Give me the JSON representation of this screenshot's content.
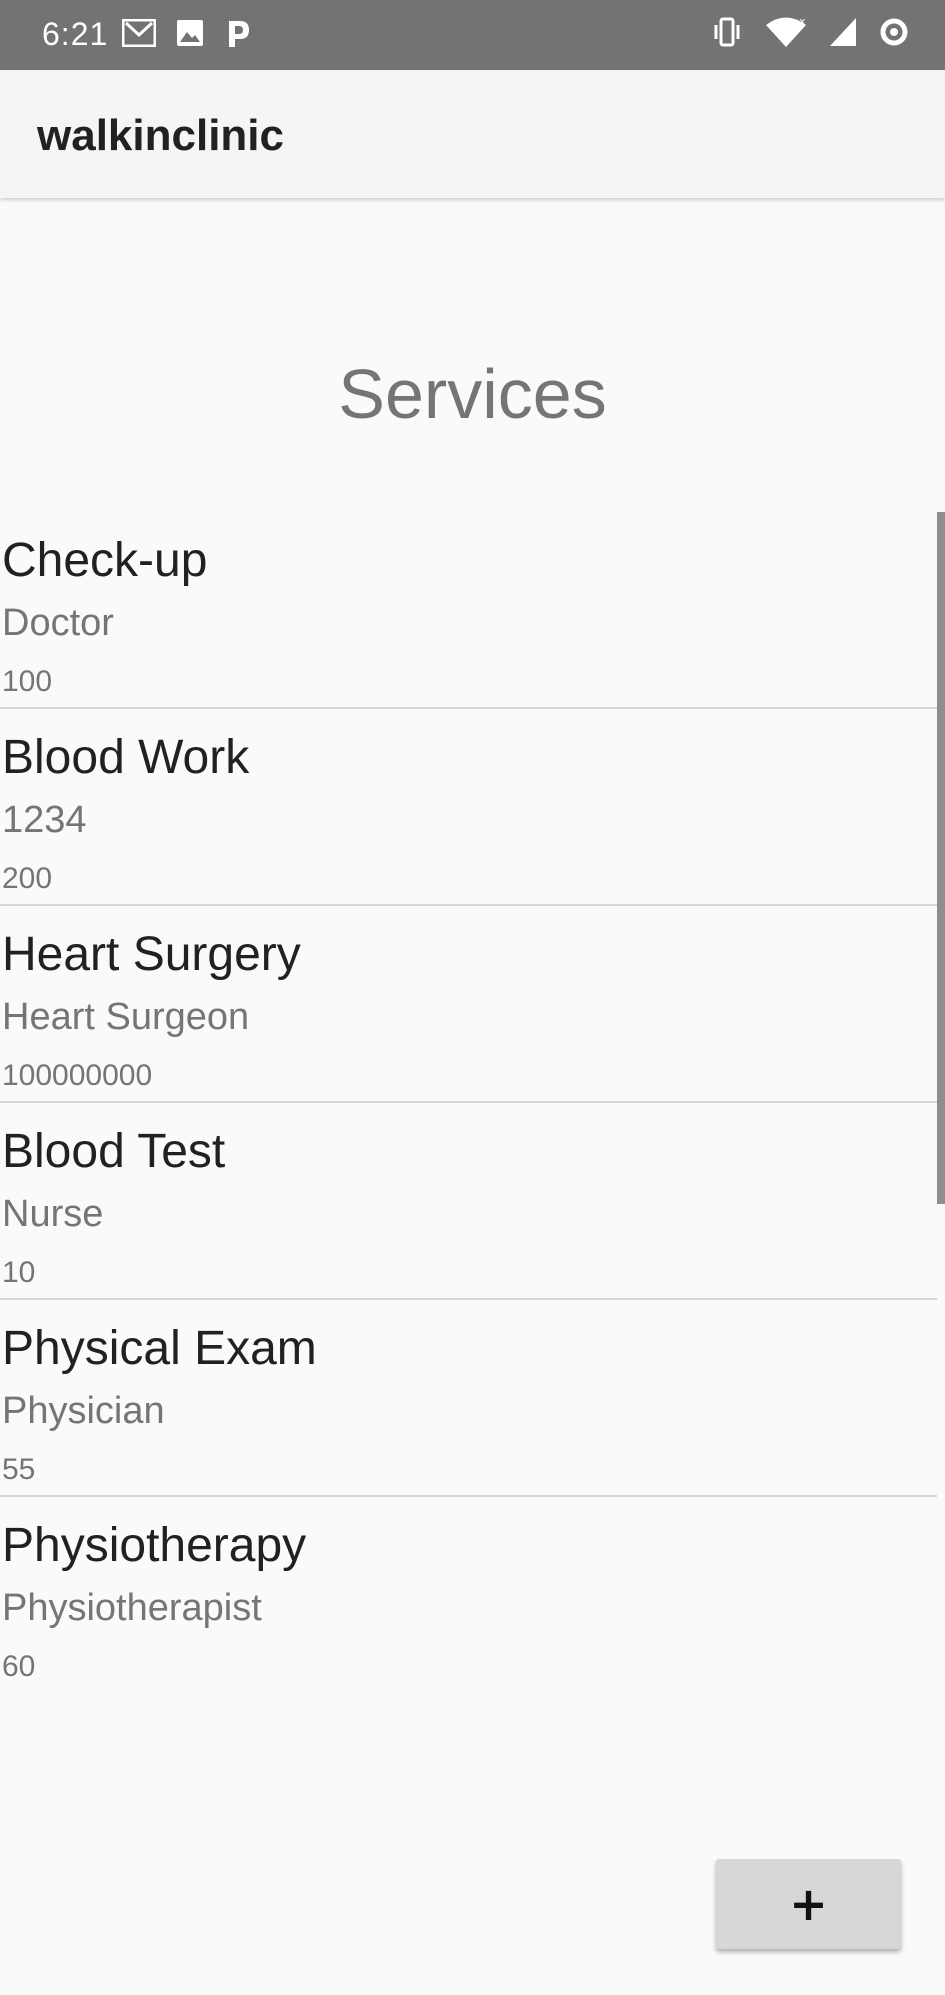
{
  "status_bar": {
    "time": "6:21",
    "left_icons": [
      "gmail-icon",
      "image-icon",
      "parking-icon"
    ],
    "right_icons": [
      "vibrate-icon",
      "wifi-icon",
      "signal-icon",
      "sync-icon"
    ]
  },
  "app_bar": {
    "title": "walkinclinic"
  },
  "page": {
    "heading": "Services"
  },
  "services": [
    {
      "name": "Check-up",
      "provider": "Doctor",
      "price": "100"
    },
    {
      "name": "Blood Work",
      "provider": "1234",
      "price": "200"
    },
    {
      "name": "Heart Surgery",
      "provider": "Heart Surgeon",
      "price": "100000000"
    },
    {
      "name": "Blood Test",
      "provider": "Nurse",
      "price": "10"
    },
    {
      "name": "Physical Exam",
      "provider": "Physician",
      "price": "55"
    },
    {
      "name": "Physiotherapy",
      "provider": "Physiotherapist",
      "price": "60"
    }
  ],
  "add_button": {
    "label": "+"
  },
  "colors": {
    "status_bar": "#737373",
    "app_bar": "#f5f5f5",
    "background": "#fafafa",
    "button": "#d6d7d7"
  }
}
